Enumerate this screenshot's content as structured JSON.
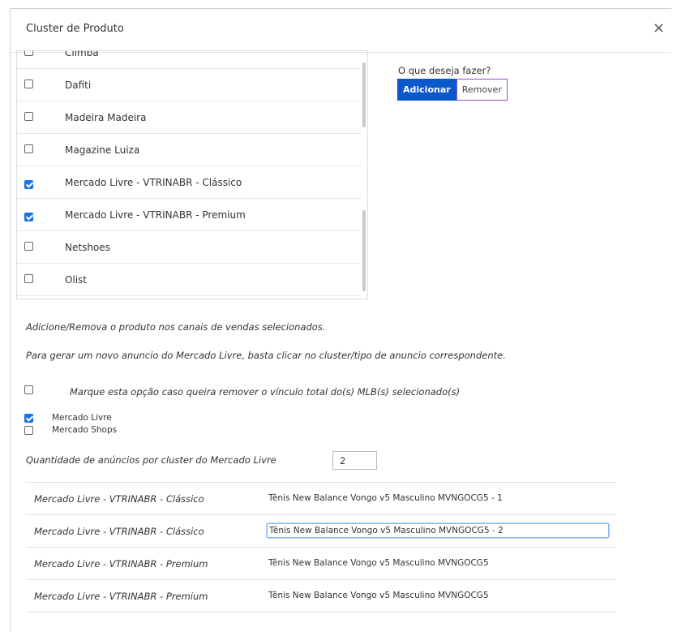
{
  "modal": {
    "title": "Cluster de Produto",
    "close_label": "×"
  },
  "channels": [
    {
      "label": "Climba",
      "checked": false
    },
    {
      "label": "Dafiti",
      "checked": false
    },
    {
      "label": "Madeira Madeira",
      "checked": false
    },
    {
      "label": "Magazine Luiza",
      "checked": false
    },
    {
      "label": "Mercado Livre - VTRINABR - Clássico",
      "checked": true
    },
    {
      "label": "Mercado Livre - VTRINABR - Premium",
      "checked": true
    },
    {
      "label": "Netshoes",
      "checked": false
    },
    {
      "label": "Olist",
      "checked": false
    }
  ],
  "action": {
    "prompt": "O que deseja fazer?",
    "add_label": "Adicionar",
    "remove_label": "Remover"
  },
  "info": {
    "line1": "Adicione/Remova o produto nos canais de vendas selecionados.",
    "line2": "Para gerar um novo anuncio do Mercado Livre, basta clicar no cluster/tipo de anuncio correspondente."
  },
  "remove_link_option": {
    "label": "Marque esta opção caso queira remover o vínculo total do(s) MLB(s) selecionado(s)",
    "checked": false
  },
  "marketplaces": [
    {
      "label": "Mercado Livre",
      "checked": true
    },
    {
      "label": "Mercado Shops",
      "checked": false
    }
  ],
  "quantity": {
    "label": "Quantidade de anúncios por cluster do Mercado Livre",
    "value": "2"
  },
  "listings": [
    {
      "cluster": "Mercado Livre - VTRINABR - Clássico",
      "title": "Tênis New Balance Vongo v5 Masculino MVNGOCG5 - 1",
      "editing": false
    },
    {
      "cluster": "Mercado Livre - VTRINABR - Clássico",
      "title": "Tênis New Balance Vongo v5 Masculino MVNGOCG5 - 2",
      "editing": true
    },
    {
      "cluster": "Mercado Livre - VTRINABR - Premium",
      "title": "Tênis New Balance Vongo v5 Masculino MVNGOCG5",
      "editing": false
    },
    {
      "cluster": "Mercado Livre - VTRINABR - Premium",
      "title": "Tênis New Balance Vongo v5 Masculino MVNGOCG5",
      "editing": false
    }
  ],
  "colors": {
    "primary": "#0a58ca",
    "remove_border": "#8a4fd0",
    "checkbox_checked": "#1a73e8"
  }
}
